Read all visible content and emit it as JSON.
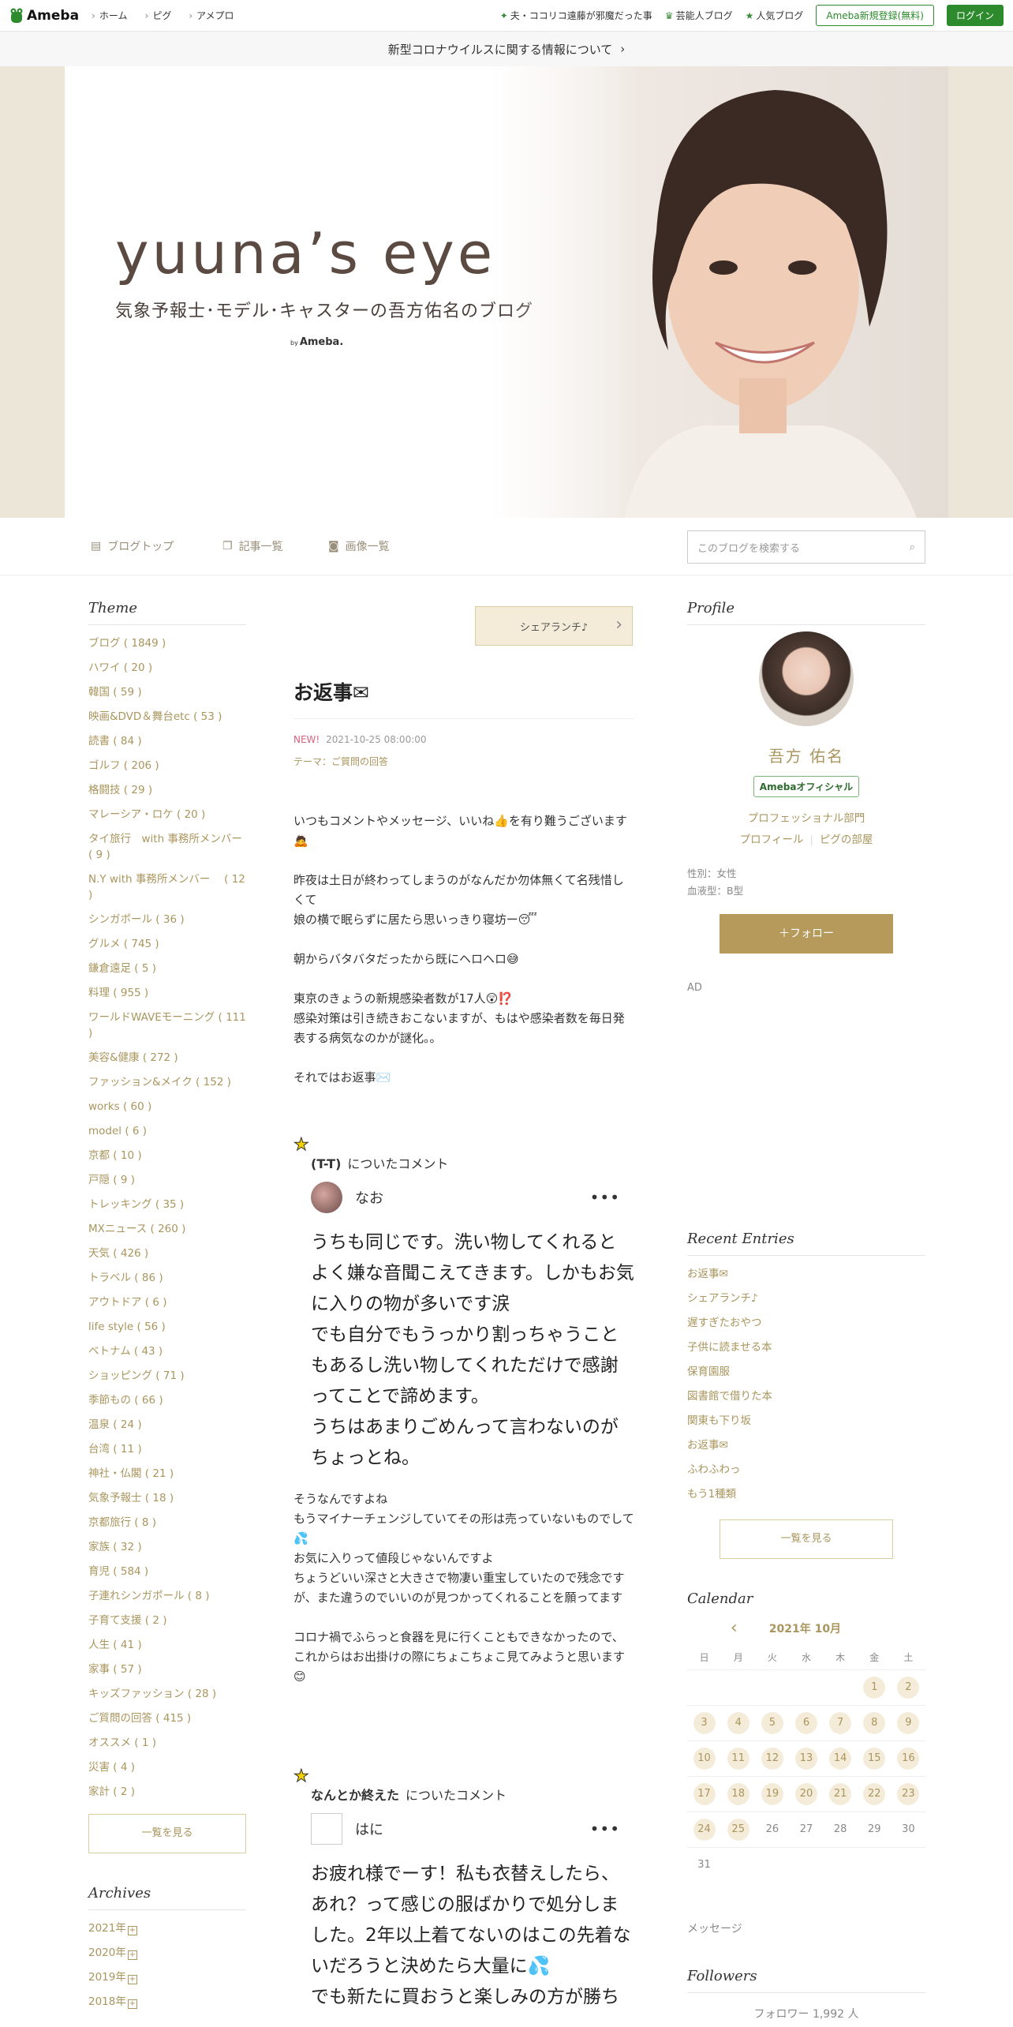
{
  "topnav": {
    "logo": "Ameba",
    "links": [
      "ホーム",
      "ピグ",
      "アメプロ"
    ],
    "right_links": [
      {
        "label": "夫・ココリコ遠藤が邪魔だった事",
        "icon": "sparkle-icon"
      },
      {
        "label": "芸能人ブログ",
        "icon": "crown-icon"
      },
      {
        "label": "人気ブログ",
        "icon": "star-icon"
      }
    ],
    "register_label": "Ameba新規登録(無料)",
    "login_label": "ログイン"
  },
  "covid_banner": "新型コロナウイルスに関する情報について",
  "hero": {
    "title": "yuuna’s eye",
    "subtitle": "気象予報士･モデル･キャスターの吾方佑名のブログ",
    "by": "by",
    "brand": "Ameba."
  },
  "blogmenu": {
    "items": [
      "ブログトップ",
      "記事一覧",
      "画像一覧"
    ],
    "search_placeholder": "このブログを検索する"
  },
  "left": {
    "theme_title": "Theme",
    "themes": [
      "ブログ ( 1849 )",
      "ハワイ ( 20 )",
      "韓国 ( 59 )",
      "映画&DVD＆舞台etc ( 53 )",
      "読書 ( 84 )",
      "ゴルフ ( 206 )",
      "格闘技 ( 29 )",
      "マレーシア・ロケ ( 20 )",
      "タイ旅行　with 事務所メンバー ( 9 )",
      "N.Y with 事務所メンバー　 ( 12 )",
      "シンガポール ( 36 )",
      "グルメ ( 745 )",
      "鎌倉遠足 ( 5 )",
      "料理 ( 955 )",
      "ワールドWAVEモーニング ( 111 )",
      "美容&健康 ( 272 )",
      "ファッション&メイク ( 152 )",
      "works ( 60 )",
      "model ( 6 )",
      "京都 ( 10 )",
      "戸隠 ( 9 )",
      "トレッキング ( 35 )",
      "MXニュース ( 260 )",
      "天気 ( 426 )",
      "トラベル ( 86 )",
      "アウトドア ( 6 )",
      "life style ( 56 )",
      "ベトナム ( 43 )",
      "ショッピング ( 71 )",
      "季節もの ( 66 )",
      "温泉 ( 24 )",
      "台湾 ( 11 )",
      "神社・仏閣 ( 21 )",
      "気象予報士 ( 18 )",
      "京都旅行 ( 8 )",
      "家族 ( 32 )",
      "育児 ( 584 )",
      "子連れシンガポール ( 8 )",
      "子育て支援 ( 2 )",
      "人生 ( 41 )",
      "家事 ( 57 )",
      "キッズファッション ( 28 )",
      "ご質問の回答 ( 415 )",
      "オススメ ( 1 )",
      "災害 ( 4 )",
      "家計 ( 2 )"
    ],
    "see_all": "一覧を見る",
    "archives_title": "Archives",
    "archives": [
      "2021年",
      "2020年",
      "2019年",
      "2018年"
    ]
  },
  "main": {
    "share_label": "シェアランチ♪",
    "title": "お返事✉",
    "new_label": "NEW!",
    "date": "2021-10-25 08:00:00",
    "theme": "テーマ：ご質問の回答",
    "body": [
      "いつもコメントやメッセージ、いいね👍を有り難うございます🙇",
      "昨夜は土日が終わってしまうのがなんだか勿体無くて名残惜しくて\n娘の横で眠らずに居たら思いっきり寝坊ー😴",
      "朝からバタバタだったから既にヘロヘロ😅",
      "東京のきょうの新規感染者数が17人😲⁉️\n感染対策は引き続きおこないますが、もはや感染者数を毎日発表する病気なのかが謎化。。",
      "それではお返事✉️"
    ],
    "comments": [
      {
        "title": "(T-T)",
        "suffix": "についたコメント",
        "user": "なお",
        "text": "うちも同じです。洗い物してくれるとよく嫌な音聞こえてきます。しかもお気に入りの物が多いです涙\nでも自分でもうっかり割っちゃうこともあるし洗い物してくれただけで感謝ってことで諦めます。\nうちはあまりごめんって言わないのがちょっとね。",
        "replies": [
          "そうなんですよね\nもうマイナーチェンジしていてその形は売っていないものでして💦\nお気に入りって値段じゃないんですよ\nちょうどいい深さと大きさで物凄い重宝していたので残念ですが、また違うのでいいのが見つかってくれることを願ってます",
          "コロナ禍でふらっと食器を見に行くこともできなかったので、これからはお出掛けの際にちょこちょこ見てみようと思います😊"
        ]
      },
      {
        "title": "なんとか終えた",
        "suffix": "についたコメント",
        "user": "はに",
        "text": "お疲れ様でーす！私も衣替えしたら、あれ？って感じの服ばかりで処分しました。2年以上着てないのはこの先着ないだろうと決めたら大量に💦\nでも新たに買おうと楽しみの方が勝ち",
        "replies": []
      }
    ]
  },
  "right": {
    "profile_title": "Profile",
    "name": "吾方 佑名",
    "badge": "Amebaオフィシャル",
    "category": "プロフェッショナル部門",
    "profile_link": "プロフィール",
    "pigg_link": "ピグの部屋",
    "gender": "性別：女性",
    "blood": "血液型：B型",
    "follow_label": "＋フォロー",
    "ad_label": "AD",
    "recent_title": "Recent Entries",
    "recent": [
      "お返事✉",
      "シェアランチ♪",
      "遅すぎたおやつ",
      "子供に読ませる本",
      "保育園服",
      "図書館で借りた本",
      "関東も下り坂",
      "お返事✉",
      "ふわふわっ",
      "もう1種類"
    ],
    "see_all": "一覧を見る",
    "calendar_title": "Calendar",
    "month": "2021年 10月",
    "weekdays": [
      "日",
      "月",
      "火",
      "水",
      "木",
      "金",
      "土"
    ],
    "days": [
      [
        "",
        "",
        "",
        "",
        "",
        "1",
        "2"
      ],
      [
        "3",
        "4",
        "5",
        "6",
        "7",
        "8",
        "9"
      ],
      [
        "10",
        "11",
        "12",
        "13",
        "14",
        "15",
        "16"
      ],
      [
        "17",
        "18",
        "19",
        "20",
        "21",
        "22",
        "23"
      ],
      [
        "24",
        "25",
        "26",
        "27",
        "28",
        "29",
        "30"
      ],
      [
        "31",
        "",
        "",
        "",
        "",
        "",
        ""
      ]
    ],
    "highlighted_through": 25,
    "message_label": "メッセージ",
    "followers_title": "Followers",
    "followers_count": "フォロワー 1,992 人"
  }
}
